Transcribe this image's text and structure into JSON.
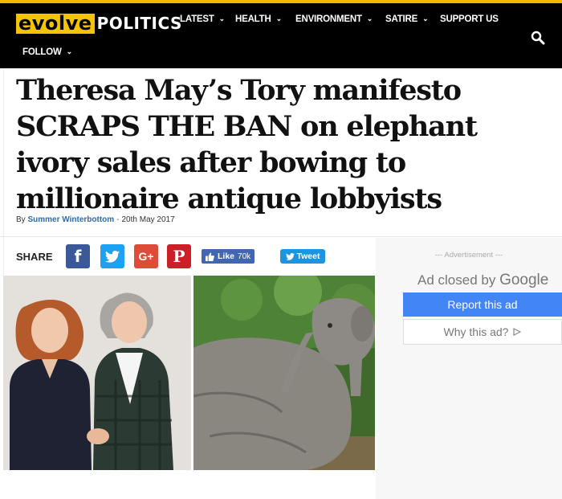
{
  "site": {
    "logo_part1": "evolve",
    "logo_part2": "POLITICS",
    "brand_color": "#f5c400"
  },
  "nav": {
    "items": [
      {
        "label": "LATEST",
        "has_dropdown": true
      },
      {
        "label": "HEALTH",
        "has_dropdown": true
      },
      {
        "label": "ENVIRONMENT",
        "has_dropdown": true
      },
      {
        "label": "SATIRE",
        "has_dropdown": true
      },
      {
        "label": "SUPPORT US",
        "has_dropdown": false
      },
      {
        "label": "FOLLOW",
        "has_dropdown": true
      }
    ],
    "search_icon": "search-icon"
  },
  "article": {
    "headline": "Theresa May’s Tory manifesto SCRAPS THE BAN on elephant ivory sales after bowing to millionaire antique lobbyists",
    "byline_prefix": "By",
    "author": "Summer Winterbottom",
    "date": "20th May 2017"
  },
  "share": {
    "label": "SHARE",
    "buttons": [
      "facebook-icon",
      "twitter-icon",
      "google-plus-icon",
      "pinterest-icon"
    ],
    "facebook_glyph": "f",
    "google_glyph": "G+",
    "pinterest_glyph": "P",
    "like_label": "Like",
    "like_count": "70k",
    "tweet_label": "Tweet"
  },
  "ad": {
    "label": "--- Advertisement ---",
    "closed_text": "Ad closed by",
    "closed_brand": "Google",
    "report_label": "Report this ad",
    "why_label": "Why this ad?"
  }
}
